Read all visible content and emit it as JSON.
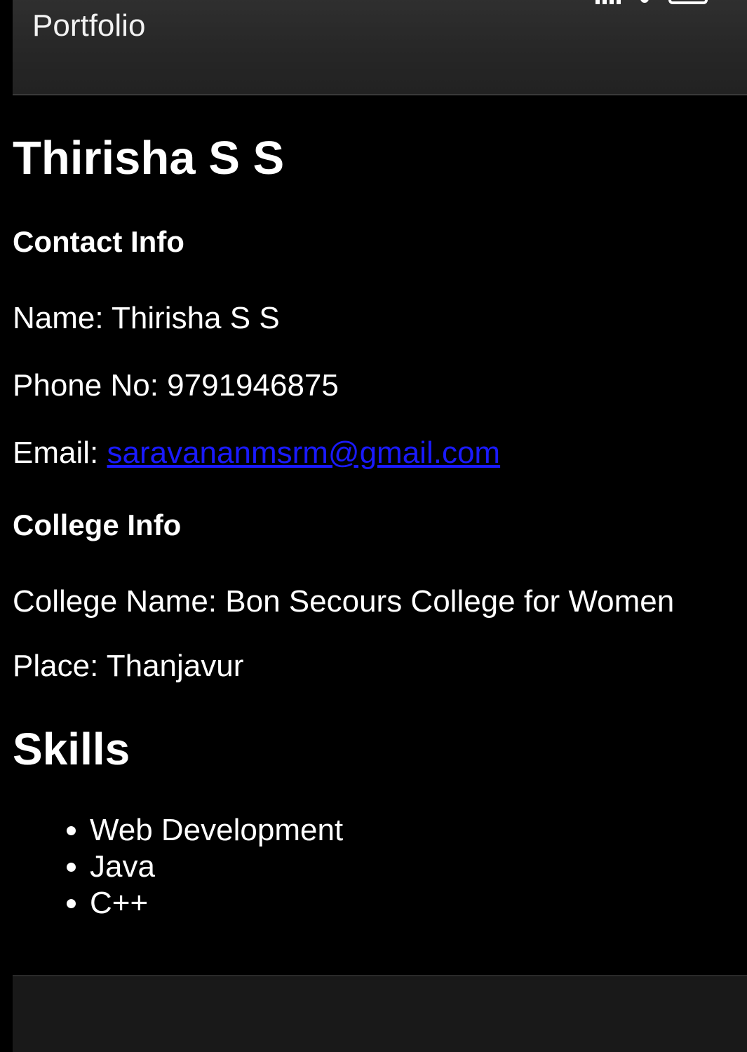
{
  "app_bar": {
    "title": "Portfolio",
    "status_icons": [
      "signal-icon",
      "wifi-icon",
      "battery-icon"
    ]
  },
  "profile": {
    "name_heading": "Thirisha S S"
  },
  "contact": {
    "heading": "Contact Info",
    "name_label": "Name: ",
    "name_value": "Thirisha S S",
    "phone_label": "Phone No: ",
    "phone_value": "9791946875",
    "email_label": "Email: ",
    "email_value": "saravananmsrm@gmail.com"
  },
  "college": {
    "heading": "College Info",
    "name_label": "College Name: ",
    "name_value": "Bon Secours College for Women",
    "place_label": "Place: ",
    "place_value": "Thanjavur"
  },
  "skills": {
    "heading": "Skills",
    "items": [
      "Web Development",
      "Java",
      "C++"
    ]
  },
  "colors": {
    "background": "#000000",
    "app_bar": "#2b2b2b",
    "text": "#ffffff",
    "link": "#1a1aff",
    "bottom_bar": "#191919"
  }
}
